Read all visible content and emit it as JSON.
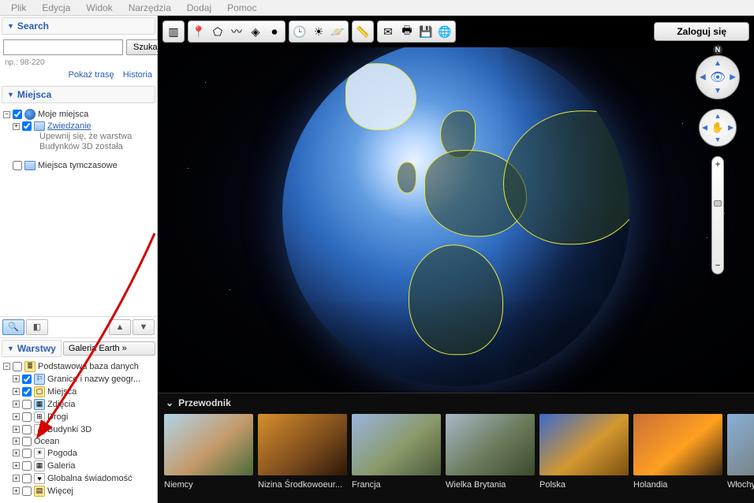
{
  "menu": {
    "items": [
      "Plik",
      "Edycja",
      "Widok",
      "Narzędzia",
      "Dodaj",
      "Pomoc"
    ]
  },
  "sidebar": {
    "search": {
      "title": "Search",
      "button": "Szukaj",
      "hint": "np.: 98-220",
      "route": "Pokaż trasę",
      "history": "Historia"
    },
    "places": {
      "title": "Miejsca",
      "myplaces": "Moje miejsca",
      "tour": "Zwiedzanie",
      "tour_note1": "Upewnij się, że warstwa",
      "tour_note2": "Budynków 3D została",
      "temp": "Miejsca tymczasowe"
    },
    "layers": {
      "title": "Warstwy",
      "gallery_btn": "Galeria Earth"
    },
    "layer_tree": {
      "root": "Podstawowa baza danych",
      "items": [
        {
          "label": "Granice i nazwy geogr...",
          "checked": true,
          "ico": "blue",
          "glyph": "⚐"
        },
        {
          "label": "Miejsca",
          "checked": true,
          "ico": "yellow",
          "glyph": "▢"
        },
        {
          "label": "Zdjęcia",
          "checked": false,
          "ico": "blue",
          "glyph": "▦"
        },
        {
          "label": "Drogi",
          "checked": false,
          "ico": "white",
          "glyph": "⊞"
        },
        {
          "label": "Budynki 3D",
          "checked": false,
          "ico": "white",
          "glyph": "⌂"
        },
        {
          "label": "Ocean",
          "checked": false,
          "ico": "globe",
          "glyph": ""
        },
        {
          "label": "Pogoda",
          "checked": false,
          "ico": "white",
          "glyph": "☀"
        },
        {
          "label": "Galeria",
          "checked": false,
          "ico": "white",
          "glyph": "▦"
        },
        {
          "label": "Globalna świadomość",
          "checked": false,
          "ico": "white",
          "glyph": "♥"
        },
        {
          "label": "Więcej",
          "checked": false,
          "ico": "yellow",
          "glyph": "▤"
        }
      ]
    }
  },
  "toolbar": {
    "login": "Zaloguj się",
    "icons": {
      "hide": "▥",
      "pin": "📍",
      "polygon": "⬠",
      "path": "〰",
      "overlay": "◈",
      "record": "⏺",
      "history": "🕒",
      "sun": "☀",
      "sky": "🪐",
      "ruler": "📏",
      "mail": "✉",
      "print": "🖶",
      "save": "💾",
      "maps": "🌐"
    }
  },
  "compass": {
    "n": "N"
  },
  "guide": {
    "title": "Przewodnik",
    "items": [
      {
        "label": "Niemcy",
        "bg": "linear-gradient(140deg,#b0d4e8,#c59a6a 55%,#4a6a3a)"
      },
      {
        "label": "Nizina Środkowoeur...",
        "bg": "linear-gradient(140deg,#d6902c,#7a4a1c 60%,#2a1808)"
      },
      {
        "label": "Francja",
        "bg": "linear-gradient(140deg,#9ab4e0,#8a9a6a 55%,#4a5a3a)"
      },
      {
        "label": "Wielka Brytania",
        "bg": "linear-gradient(140deg,#a8b8c8,#6a7a5a 55%,#3a4a2a)"
      },
      {
        "label": "Polska",
        "bg": "linear-gradient(140deg,#3a6acc,#d49830 55%,#7a5010)"
      },
      {
        "label": "Holandia",
        "bg": "linear-gradient(140deg,#c87038,#ffa020 55%,#3a2810)"
      },
      {
        "label": "Włochy",
        "bg": "linear-gradient(140deg,#8ab0d8,#7a8a90 55%,#4a5a60)"
      }
    ]
  }
}
